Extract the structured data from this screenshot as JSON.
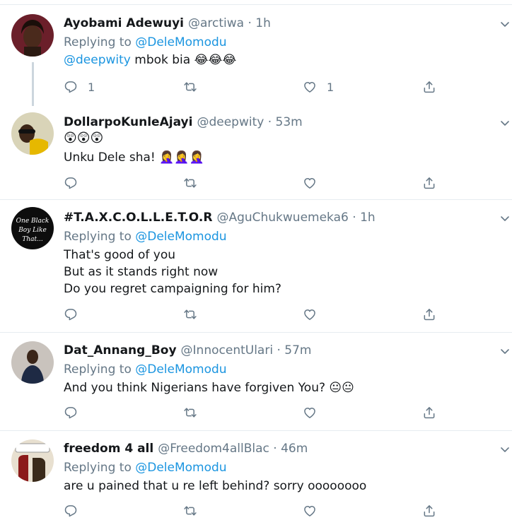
{
  "tweets": [
    {
      "name": "Ayobami Adewuyi",
      "handle": "@arctiwa",
      "time": "1h",
      "replying_label": "Replying to",
      "replying_to": "@DeleMomodu",
      "mention": "@deepwity",
      "lines": [
        "mbok bia 😂😂😂"
      ],
      "reply_count": "1",
      "like_count": "1"
    },
    {
      "name": "DollarpoKunleAjayi",
      "handle": "@deepwity",
      "time": "53m",
      "lines": [
        "😲😲😲",
        "Unku Dele sha! 🤦‍♀️🤦‍♀️🤦‍♀️"
      ]
    },
    {
      "name": "#T.A.X.C.O.L.L.E.T.O.R",
      "handle": "@AguChukwuemeka6",
      "time": "1h",
      "replying_label": "Replying to",
      "replying_to": "@DeleMomodu",
      "avatar_text": [
        "One Black",
        "Boy Like",
        "That..."
      ],
      "lines": [
        "That's good of you",
        "But as it stands right now",
        "Do you regret campaigning for him?"
      ]
    },
    {
      "name": "Dat_Annang_Boy",
      "handle": "@InnocentUlari",
      "time": "57m",
      "replying_label": "Replying to",
      "replying_to": "@DeleMomodu",
      "lines": [
        "And you think Nigerians have forgiven You? 😐😐"
      ]
    },
    {
      "name": "freedom 4 all",
      "handle": "@Freedom4allBlac",
      "time": "46m",
      "replying_label": "Replying to",
      "replying_to": "@DeleMomodu",
      "lines": [
        "are u pained that u re left behind? sorry oooooooo"
      ]
    }
  ],
  "separator": "·",
  "icons": [
    "reply-icon",
    "retweet-icon",
    "like-icon",
    "share-icon",
    "chevron-down-icon"
  ],
  "colors": {
    "link": "#1b95e0",
    "muted": "#657786",
    "divider": "#e6ecf0"
  }
}
